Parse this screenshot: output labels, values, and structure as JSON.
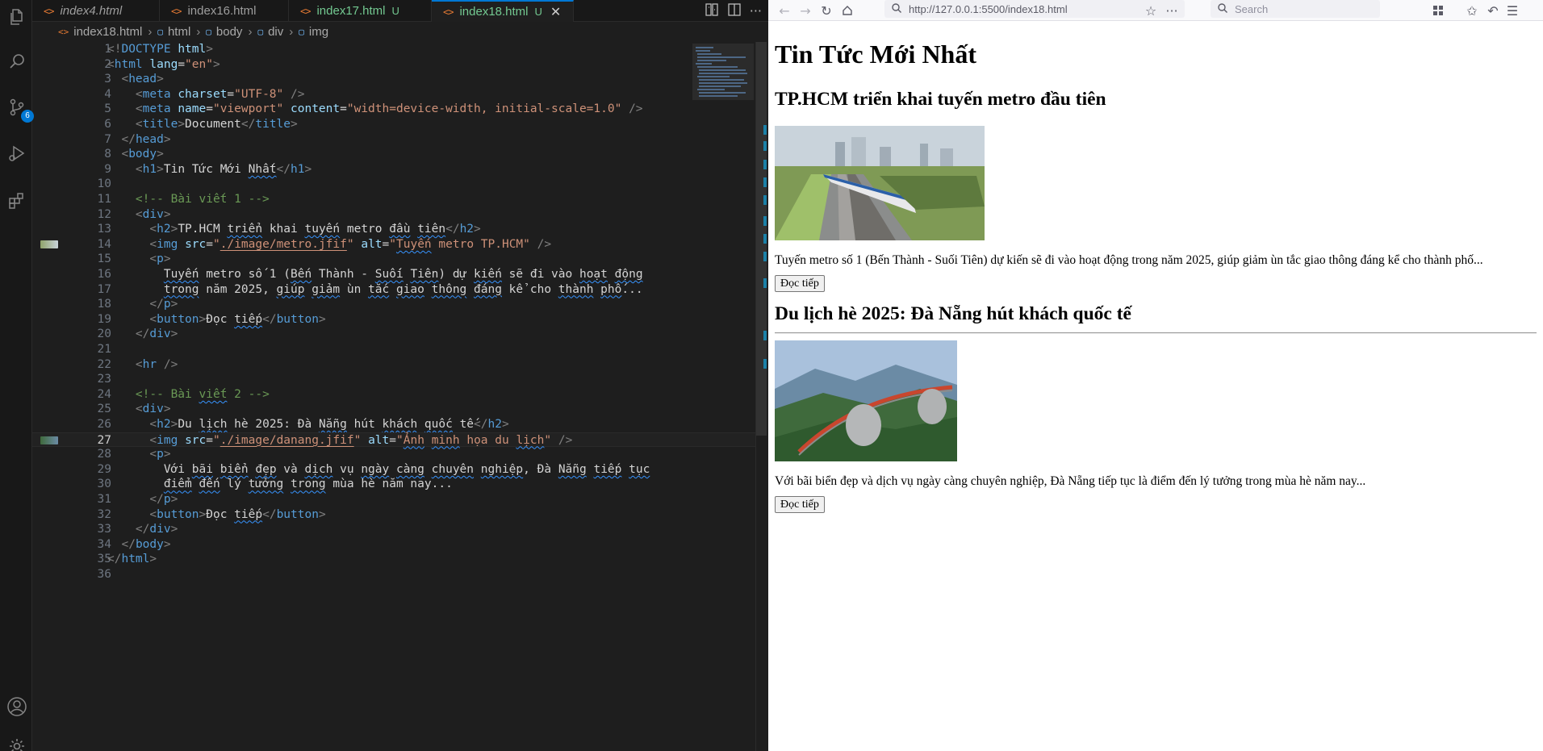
{
  "editor": {
    "tabs": [
      {
        "label": "index4.html",
        "status": "",
        "active": false
      },
      {
        "label": "index16.html",
        "status": "",
        "active": false
      },
      {
        "label": "index17.html",
        "status": "U",
        "active": false
      },
      {
        "label": "index18.html",
        "status": "U",
        "active": true
      }
    ],
    "breadcrumb": [
      "index18.html",
      "html",
      "body",
      "div",
      "img"
    ],
    "scm_badge": "6",
    "lines": [
      {
        "n": "1",
        "html": "<span class='t-br'>&lt;!</span><span class='t-tag'>DOCTYPE</span> <span class='t-attr'>html</span><span class='t-br'>&gt;</span>"
      },
      {
        "n": "2",
        "html": "<span class='t-br'>&lt;</span><span class='t-tag'>html</span> <span class='t-attr'>lang</span>=<span class='t-str'>\"en\"</span><span class='t-br'>&gt;</span>"
      },
      {
        "n": "3",
        "html": "  <span class='t-br'>&lt;</span><span class='t-tag'>head</span><span class='t-br'>&gt;</span>"
      },
      {
        "n": "4",
        "html": "    <span class='t-br'>&lt;</span><span class='t-tag'>meta</span> <span class='t-attr'>charset</span>=<span class='t-str'>\"UTF-8\"</span> <span class='t-br'>/&gt;</span>"
      },
      {
        "n": "5",
        "html": "    <span class='t-br'>&lt;</span><span class='t-tag'>meta</span> <span class='t-attr'>name</span>=<span class='t-str'>\"viewport\"</span> <span class='t-attr'>content</span>=<span class='t-str'>\"width=device-width, initial-scale=1.0\"</span> <span class='t-br'>/&gt;</span>"
      },
      {
        "n": "6",
        "html": "    <span class='t-br'>&lt;</span><span class='t-tag'>title</span><span class='t-br'>&gt;</span>Document<span class='t-br'>&lt;/</span><span class='t-tag'>title</span><span class='t-br'>&gt;</span>"
      },
      {
        "n": "7",
        "html": "  <span class='t-br'>&lt;/</span><span class='t-tag'>head</span><span class='t-br'>&gt;</span>"
      },
      {
        "n": "8",
        "html": "  <span class='t-br'>&lt;</span><span class='t-tag'>body</span><span class='t-br'>&gt;</span>"
      },
      {
        "n": "9",
        "html": "    <span class='t-br'>&lt;</span><span class='t-tag'>h1</span><span class='t-br'>&gt;</span>Tin Tức Mới <span class='sq'>Nhất</span><span class='t-br'>&lt;/</span><span class='t-tag'>h1</span><span class='t-br'>&gt;</span>"
      },
      {
        "n": "10",
        "html": ""
      },
      {
        "n": "11",
        "html": "    <span class='t-cmt'>&lt;!-- Bài viết 1 --&gt;</span>"
      },
      {
        "n": "12",
        "html": "    <span class='t-br'>&lt;</span><span class='t-tag'>div</span><span class='t-br'>&gt;</span>"
      },
      {
        "n": "13",
        "html": "      <span class='t-br'>&lt;</span><span class='t-tag'>h2</span><span class='t-br'>&gt;</span>TP.HCM <span class='sq'>triển</span> khai <span class='sq'>tuyến</span> metro <span class='sq'>đầu</span> <span class='sq'>tiên</span><span class='t-br'>&lt;/</span><span class='t-tag'>h2</span><span class='t-br'>&gt;</span>"
      },
      {
        "n": "14",
        "html": "      <span class='t-br'>&lt;</span><span class='t-tag'>img</span> <span class='t-attr'>src</span>=<span class='t-str'>\"<span class='und'>./image/metro.jfif</span>\"</span> <span class='t-attr'>alt</span>=<span class='t-str'>\"<span class='sq'>Tuyến</span> metro TP.HCM\"</span> <span class='t-br'>/&gt;</span>"
      },
      {
        "n": "15",
        "html": "      <span class='t-br'>&lt;</span><span class='t-tag'>p</span><span class='t-br'>&gt;</span>"
      },
      {
        "n": "16",
        "html": "        <span class='sq'>Tuyến</span> metro số 1 (<span class='sq'>Bến</span> Thành - <span class='sq'>Suối</span> <span class='sq'>Tiên</span>) dự <span class='sq'>kiến</span> sẽ đi vào <span class='sq'>hoạt</span> <span class='sq'>động</span>"
      },
      {
        "n": "17",
        "html": "        <span class='sq'>trong</span> năm 2025, <span class='sq'>giúp</span> <span class='sq'>giảm</span> ùn <span class='sq'>tắc</span> <span class='sq'>giao</span> <span class='sq'>thông</span> <span class='sq'>đáng</span> kể cho <span class='sq'>thành</span> <span class='sq'>phố</span>..."
      },
      {
        "n": "18",
        "html": "      <span class='t-br'>&lt;/</span><span class='t-tag'>p</span><span class='t-br'>&gt;</span>"
      },
      {
        "n": "19",
        "html": "      <span class='t-br'>&lt;</span><span class='t-tag'>button</span><span class='t-br'>&gt;</span>Đọc <span class='sq'>tiếp</span><span class='t-br'>&lt;/</span><span class='t-tag'>button</span><span class='t-br'>&gt;</span>"
      },
      {
        "n": "20",
        "html": "    <span class='t-br'>&lt;/</span><span class='t-tag'>div</span><span class='t-br'>&gt;</span>"
      },
      {
        "n": "21",
        "html": ""
      },
      {
        "n": "22",
        "html": "    <span class='t-br'>&lt;</span><span class='t-tag'>hr</span> <span class='t-br'>/&gt;</span>"
      },
      {
        "n": "23",
        "html": ""
      },
      {
        "n": "24",
        "html": "    <span class='t-cmt'>&lt;!-- Bài <span class='sq'>viết</span> 2 --&gt;</span>"
      },
      {
        "n": "25",
        "html": "    <span class='t-br'>&lt;</span><span class='t-tag'>div</span><span class='t-br'>&gt;</span>"
      },
      {
        "n": "26",
        "html": "      <span class='t-br'>&lt;</span><span class='t-tag'>h2</span><span class='t-br'>&gt;</span>Du <span class='sq'>lịch</span> hè 2025: Đà <span class='sq'>Nẵng</span> hút <span class='sq'>khách</span> <span class='sq'>quốc</span> tế<span class='t-br'>&lt;/</span><span class='t-tag'>h2</span><span class='t-br'>&gt;</span>"
      },
      {
        "n": "27",
        "html": "      <span class='t-br'>&lt;</span><span class='t-tag'>img</span> <span class='t-attr'>src</span>=<span class='t-str'>\"<span class='und'>./image/danang.jfif</span>\"</span> <span class='t-attr'>alt</span>=<span class='t-str'>\"<span class='sq'>Ảnh</span> <span class='sq'>minh</span> họa du <span class='sq'>lịch</span>\"</span> <span class='t-br'>/&gt;</span>"
      },
      {
        "n": "28",
        "html": "      <span class='t-br'>&lt;</span><span class='t-tag'>p</span><span class='t-br'>&gt;</span>"
      },
      {
        "n": "29",
        "html": "        Với <span class='sq'>bãi</span> <span class='sq'>biển</span> <span class='sq'>đẹp</span> và <span class='sq'>dịch</span> vụ <span class='sq'>ngày</span> <span class='sq'>càng</span> <span class='sq'>chuyên</span> <span class='sq'>nghiệp</span>, Đà <span class='sq'>Nẵng</span> <span class='sq'>tiếp</span> <span class='sq'>tục</span>"
      },
      {
        "n": "30",
        "html": "        <span class='sq'>điểm</span> <span class='sq'>đến</span> lý <span class='sq'>tưởng</span> <span class='sq'>trong</span> mùa hè năm nay..."
      },
      {
        "n": "31",
        "html": "      <span class='t-br'>&lt;/</span><span class='t-tag'>p</span><span class='t-br'>&gt;</span>"
      },
      {
        "n": "32",
        "html": "      <span class='t-br'>&lt;</span><span class='t-tag'>button</span><span class='t-br'>&gt;</span>Đọc <span class='sq'>tiếp</span><span class='t-br'>&lt;/</span><span class='t-tag'>button</span><span class='t-br'>&gt;</span>"
      },
      {
        "n": "33",
        "html": "    <span class='t-br'>&lt;/</span><span class='t-tag'>div</span><span class='t-br'>&gt;</span>"
      },
      {
        "n": "34",
        "html": "  <span class='t-br'>&lt;/</span><span class='t-tag'>body</span><span class='t-br'>&gt;</span>"
      },
      {
        "n": "35",
        "html": "<span class='t-br'>&lt;/</span><span class='t-tag'>html</span><span class='t-br'>&gt;</span>"
      },
      {
        "n": "36",
        "html": ""
      }
    ],
    "current_line": "27",
    "colors": {
      "accent": "#0078d4",
      "untracked": "#73c991",
      "html_icon": "#e37933"
    }
  },
  "browser": {
    "url": "http://127.0.0.1:5500/index18.html",
    "search_placeholder": "Search",
    "page": {
      "h1": "Tin Tức Mới Nhất",
      "articles": [
        {
          "title": "TP.HCM triển khai tuyến metro đầu tiên",
          "image_alt": "Tuyến metro TP.HCM",
          "text": "Tuyến metro số 1 (Bến Thành - Suối Tiên) dự kiến sẽ đi vào hoạt động trong năm 2025, giúp giảm ùn tắc giao thông đáng kể cho thành phố...",
          "button": "Đọc tiếp"
        },
        {
          "title": "Du lịch hè 2025: Đà Nẵng hút khách quốc tế",
          "image_alt": "Ảnh minh họa du lịch",
          "text": "Với bãi biển đẹp và dịch vụ ngày càng chuyên nghiệp, Đà Nẵng tiếp tục là điểm đến lý tưởng trong mùa hè năm nay...",
          "button": "Đọc tiếp"
        }
      ]
    }
  }
}
